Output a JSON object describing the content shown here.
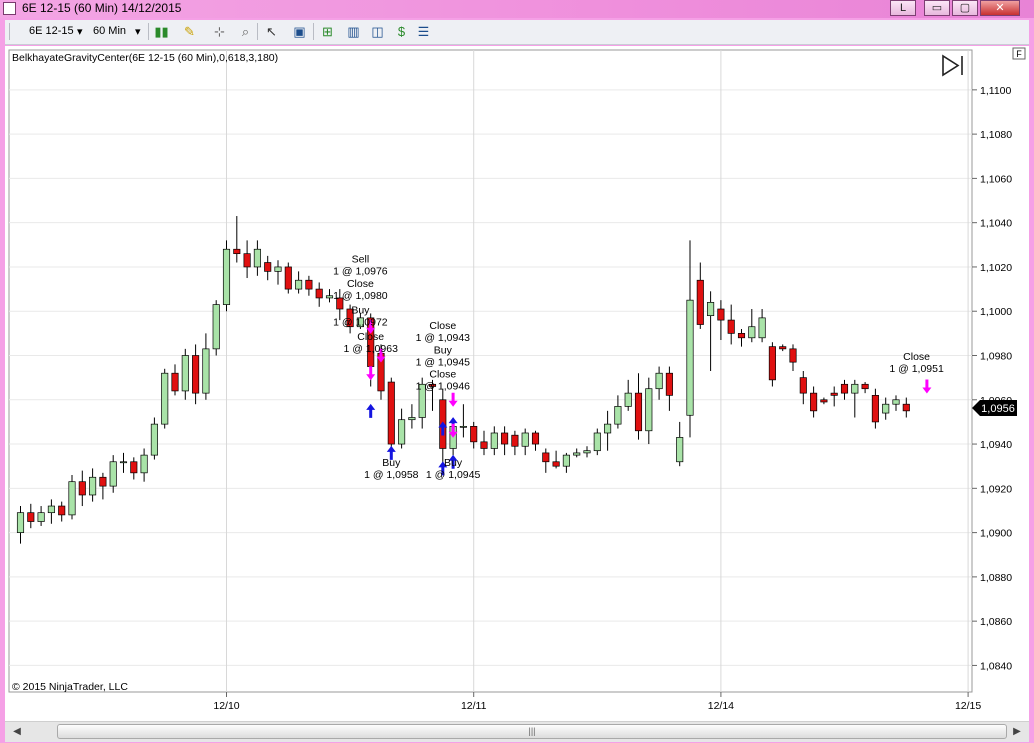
{
  "window": {
    "title": "6E 12-15 (60 Min)  14/12/2015",
    "buttons": [
      "L",
      "▭",
      "▢",
      "✕"
    ]
  },
  "toolbar": {
    "instrument": "6E 12-15",
    "interval": "60 Min",
    "icons": [
      "bar-type-icon",
      "drawing-pencil-icon",
      "crosshair-icon",
      "zoom-icon",
      "data-box-icon",
      "chart-trader-icon",
      "indicators-icon",
      "strategies-icon",
      "properties-icon"
    ]
  },
  "chart": {
    "indicator_label": "BelkhayateGravityCenter(6E 12-15 (60 Min),0,618,3,180)",
    "copyright": "© 2015 NinjaTrader, LLC",
    "price_marker": "1,0956",
    "f_box": "F",
    "colors": {
      "up": "#a9e3a8",
      "down": "#e01010",
      "buy_arrow": "#1414e0",
      "sell_arrow": "#ff00ff"
    }
  },
  "chart_data": {
    "type": "candlestick",
    "y_ticks": [
      "1,0840",
      "1,0860",
      "1,0880",
      "1,0900",
      "1,0920",
      "1,0940",
      "1,0960",
      "1,0980",
      "1,1000",
      "1,1020",
      "1,1040",
      "1,1060",
      "1,1080",
      "1,1100"
    ],
    "ylim": [
      1.0828,
      1.1118
    ],
    "x_ticks": [
      {
        "label": "12/10",
        "index": 20
      },
      {
        "label": "12/11",
        "index": 44
      },
      {
        "label": "12/14",
        "index": 68
      },
      {
        "label": "12/15",
        "index": 92
      }
    ],
    "candles": [
      [
        1.09,
        1.0909,
        1.0912,
        1.0895
      ],
      [
        1.0909,
        1.0905,
        1.0913,
        1.0902
      ],
      [
        1.0905,
        1.0909,
        1.0912,
        1.0903
      ],
      [
        1.0909,
        1.0912,
        1.0915,
        1.0904
      ],
      [
        1.0912,
        1.0908,
        1.0914,
        1.0905
      ],
      [
        1.0908,
        1.0923,
        1.0926,
        1.0906
      ],
      [
        1.0923,
        1.0917,
        1.0928,
        1.0912
      ],
      [
        1.0917,
        1.0925,
        1.0929,
        1.0914
      ],
      [
        1.0925,
        1.0921,
        1.0927,
        1.0915
      ],
      [
        1.0921,
        1.0932,
        1.0935,
        1.0918
      ],
      [
        1.0932,
        1.0932,
        1.0936,
        1.0927
      ],
      [
        1.0932,
        1.0927,
        1.0934,
        1.0924
      ],
      [
        1.0927,
        1.0935,
        1.0938,
        1.0923
      ],
      [
        1.0935,
        1.0949,
        1.0952,
        1.0933
      ],
      [
        1.0949,
        1.0972,
        1.0974,
        1.0947
      ],
      [
        1.0972,
        1.0964,
        1.0976,
        1.0962
      ],
      [
        1.0964,
        1.098,
        1.0983,
        1.096
      ],
      [
        1.098,
        1.0963,
        1.0985,
        1.0958
      ],
      [
        1.0963,
        1.0983,
        1.099,
        1.096
      ],
      [
        1.0983,
        1.1003,
        1.1005,
        1.098
      ],
      [
        1.1003,
        1.1028,
        1.1032,
        1.1
      ],
      [
        1.1028,
        1.1026,
        1.1043,
        1.1022
      ],
      [
        1.1026,
        1.102,
        1.1032,
        1.1015
      ],
      [
        1.102,
        1.1028,
        1.1032,
        1.1016
      ],
      [
        1.1022,
        1.1018,
        1.1025,
        1.1014
      ],
      [
        1.1018,
        1.102,
        1.1023,
        1.1012
      ],
      [
        1.102,
        1.101,
        1.1022,
        1.1008
      ],
      [
        1.101,
        1.1014,
        1.1018,
        1.1008
      ],
      [
        1.1014,
        1.101,
        1.1016,
        1.1007
      ],
      [
        1.101,
        1.1006,
        1.1013,
        1.1002
      ],
      [
        1.1006,
        1.1007,
        1.101,
        1.1004
      ],
      [
        1.1006,
        1.1001,
        1.101,
        1.0996
      ],
      [
        1.1001,
        1.0993,
        1.1003,
        1.099
      ],
      [
        1.0993,
        1.0997,
        1.0999,
        1.0992
      ],
      [
        1.0997,
        1.0975,
        1.0999,
        1.0966
      ],
      [
        1.0981,
        1.0964,
        1.0985,
        1.096
      ],
      [
        1.0968,
        1.094,
        1.097,
        1.0935
      ],
      [
        1.094,
        1.0951,
        1.0956,
        1.0938
      ],
      [
        1.0951,
        1.0952,
        1.0958,
        1.0947
      ],
      [
        1.0952,
        1.0967,
        1.097,
        1.0947
      ],
      [
        1.0967,
        1.0966,
        1.0969,
        1.0955
      ],
      [
        1.096,
        1.0938,
        1.0965,
        1.0926
      ],
      [
        1.0938,
        1.0948,
        1.0951,
        1.0935
      ],
      [
        1.0948,
        1.0948,
        1.0958,
        1.0943
      ],
      [
        1.0948,
        1.0941,
        1.095,
        1.0938
      ],
      [
        1.0941,
        1.0938,
        1.0946,
        1.0935
      ],
      [
        1.0938,
        1.0945,
        1.0948,
        1.0935
      ],
      [
        1.0945,
        1.094,
        1.0948,
        1.0935
      ],
      [
        1.0944,
        1.0939,
        1.0946,
        1.0935
      ],
      [
        1.0939,
        1.0945,
        1.0947,
        1.0935
      ],
      [
        1.0945,
        1.094,
        1.0946,
        1.0937
      ],
      [
        1.0936,
        1.0932,
        1.0938,
        1.0927
      ],
      [
        1.0932,
        1.093,
        1.0937,
        1.0929
      ],
      [
        1.093,
        1.0935,
        1.0936,
        1.0927
      ],
      [
        1.0935,
        1.0936,
        1.0938,
        1.0934
      ],
      [
        1.0936,
        1.0937,
        1.0939,
        1.0934
      ],
      [
        1.0937,
        1.0945,
        1.0947,
        1.0935
      ],
      [
        1.0945,
        1.0949,
        1.0955,
        1.0937
      ],
      [
        1.0949,
        1.0957,
        1.0962,
        1.0947
      ],
      [
        1.0957,
        1.0963,
        1.0969,
        1.0955
      ],
      [
        1.0963,
        1.0946,
        1.0972,
        1.0942
      ],
      [
        1.0946,
        1.0965,
        1.097,
        1.094
      ],
      [
        1.0965,
        1.0972,
        1.0975,
        1.096
      ],
      [
        1.0972,
        1.0962,
        1.0975,
        1.0955
      ],
      [
        1.0932,
        1.0943,
        1.095,
        1.093
      ],
      [
        1.0953,
        1.1005,
        1.1032,
        1.0943
      ],
      [
        1.1014,
        1.0994,
        1.1022,
        1.0992
      ],
      [
        1.0998,
        1.1004,
        1.1009,
        1.0973
      ],
      [
        1.1001,
        1.0996,
        1.1005,
        1.0987
      ],
      [
        1.0996,
        1.099,
        1.1003,
        1.0985
      ],
      [
        1.099,
        1.0988,
        1.0992,
        1.0984
      ],
      [
        1.0988,
        1.0993,
        1.1001,
        1.0986
      ],
      [
        1.0988,
        1.0997,
        1.1001,
        1.0986
      ],
      [
        1.0984,
        1.0969,
        1.0986,
        1.0966
      ],
      [
        1.0984,
        1.0983,
        1.0985,
        1.0982
      ],
      [
        1.0983,
        1.0977,
        1.0985,
        1.0973
      ],
      [
        1.097,
        1.0963,
        1.0973,
        1.0958
      ],
      [
        1.0963,
        1.0955,
        1.0966,
        1.0952
      ],
      [
        1.096,
        1.0959,
        1.0961,
        1.0958
      ],
      [
        1.0963,
        1.0962,
        1.0966,
        1.0957
      ],
      [
        1.0967,
        1.0963,
        1.0969,
        1.096
      ],
      [
        1.0963,
        1.0967,
        1.0969,
        1.0952
      ],
      [
        1.0967,
        1.0965,
        1.0968,
        1.0963
      ],
      [
        1.0962,
        1.095,
        1.0965,
        1.0947
      ],
      [
        1.0954,
        1.0958,
        1.0961,
        1.0951
      ],
      [
        1.0958,
        1.096,
        1.0962,
        1.0955
      ],
      [
        1.0958,
        1.0955,
        1.0961,
        1.0952
      ]
    ],
    "annotations": [
      {
        "lines": [
          "Sell",
          "1 @ 1,0976"
        ],
        "index": 33,
        "price": 1.1022
      },
      {
        "lines": [
          "Close",
          "1 @ 1,0980"
        ],
        "index": 33,
        "price": 1.1011
      },
      {
        "lines": [
          "Buy",
          "1 @ 1,0972"
        ],
        "index": 33,
        "price": 1.0999
      },
      {
        "lines": [
          "Close",
          "1 @ 1,0963"
        ],
        "index": 34,
        "price": 1.0987
      },
      {
        "lines": [
          "Close",
          "1 @ 1,0943"
        ],
        "index": 41,
        "price": 1.0992
      },
      {
        "lines": [
          "Buy",
          "1 @ 1,0945"
        ],
        "index": 41,
        "price": 1.0981
      },
      {
        "lines": [
          "Close",
          "1 @ 1,0946"
        ],
        "index": 41,
        "price": 1.097
      },
      {
        "lines": [
          "Buy",
          "1 @ 1,0958"
        ],
        "index": 36,
        "price": 1.093
      },
      {
        "lines": [
          "Buy",
          "1 @ 1,0945"
        ],
        "index": 42,
        "price": 1.093
      },
      {
        "lines": [
          "Close",
          "1 @ 1,0951"
        ],
        "index": 87,
        "price": 1.0978
      }
    ],
    "buy_arrows": [
      {
        "index": 34,
        "price": 1.0955
      },
      {
        "index": 36,
        "price": 1.0936
      },
      {
        "index": 41,
        "price": 1.0929
      },
      {
        "index": 42,
        "price": 1.0932
      },
      {
        "index": 41,
        "price": 1.0947
      },
      {
        "index": 42,
        "price": 1.0949
      }
    ],
    "sell_arrows": [
      {
        "index": 34,
        "price": 1.0993
      },
      {
        "index": 35,
        "price": 1.098
      },
      {
        "index": 34,
        "price": 1.0972
      },
      {
        "index": 42,
        "price": 1.096
      },
      {
        "index": 42,
        "price": 1.0946
      },
      {
        "index": 88,
        "price": 1.0966
      }
    ]
  }
}
